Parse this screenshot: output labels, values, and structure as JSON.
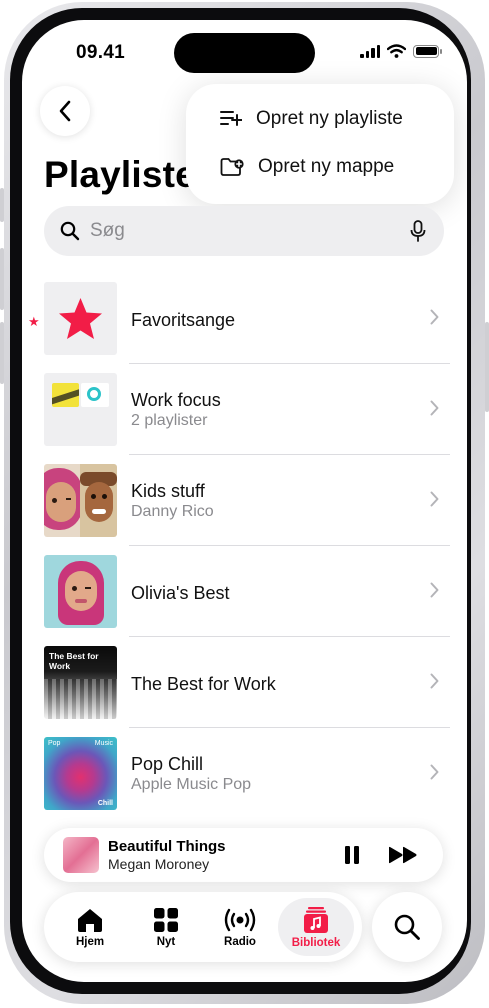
{
  "status_bar": {
    "time": "09.41"
  },
  "header": {
    "title": "Playlister"
  },
  "menu": {
    "items": [
      {
        "label": "Opret ny playliste",
        "icon": "new-playlist-icon"
      },
      {
        "label": "Opret ny mappe",
        "icon": "new-folder-icon"
      }
    ]
  },
  "search": {
    "placeholder": "Søg"
  },
  "playlists": [
    {
      "title": "Favoritsange",
      "subtitle": ""
    },
    {
      "title": "Work focus",
      "subtitle": "2 playlister"
    },
    {
      "title": "Kids stuff",
      "subtitle": "Danny Rico"
    },
    {
      "title": "Olivia's Best",
      "subtitle": ""
    },
    {
      "title": "The Best for Work",
      "subtitle": "",
      "art_text": "The Best for Work"
    },
    {
      "title": "Pop Chill",
      "subtitle": "Apple Music Pop",
      "art_text_top": "Pop",
      "art_brand": "Music",
      "art_text_bottom": "Chill"
    }
  ],
  "now_playing": {
    "song": "Beautiful Things",
    "artist": "Megan Moroney"
  },
  "tabs": [
    {
      "label": "Hjem",
      "icon": "home-icon"
    },
    {
      "label": "Nyt",
      "icon": "grid-icon"
    },
    {
      "label": "Radio",
      "icon": "radio-icon"
    },
    {
      "label": "Bibliotek",
      "icon": "library-icon",
      "active": true
    }
  ],
  "colors": {
    "accent": "#f21d47"
  }
}
